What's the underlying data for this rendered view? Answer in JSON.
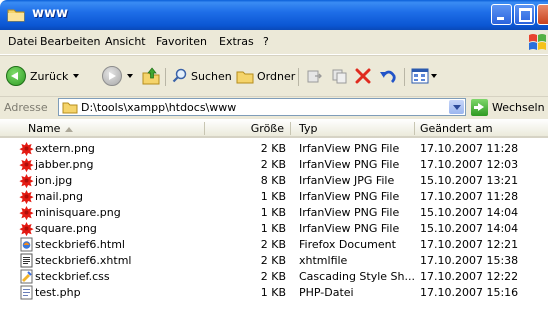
{
  "window": {
    "title": "www"
  },
  "menu": [
    "Datei",
    "Bearbeiten",
    "Ansicht",
    "Favoriten",
    "Extras",
    "?"
  ],
  "toolbar": {
    "back_label": "Zurück",
    "search_label": "Suchen",
    "folders_label": "Ordner"
  },
  "address": {
    "label": "Adresse",
    "path": "D:\\tools\\xampp\\htdocs\\www",
    "go_label": "Wechseln zu"
  },
  "columns": {
    "name": "Name",
    "size": "Größe",
    "type": "Typ",
    "modified": "Geändert am"
  },
  "files": [
    {
      "icon": "irfanview-icon",
      "name": "extern.png",
      "size": "2 KB",
      "type": "IrfanView PNG File",
      "modified": "17.10.2007 11:28"
    },
    {
      "icon": "irfanview-icon",
      "name": "jabber.png",
      "size": "2 KB",
      "type": "IrfanView PNG File",
      "modified": "17.10.2007 12:03"
    },
    {
      "icon": "irfanview-icon",
      "name": "jon.jpg",
      "size": "8 KB",
      "type": "IrfanView JPG File",
      "modified": "15.10.2007 13:21"
    },
    {
      "icon": "irfanview-icon",
      "name": "mail.png",
      "size": "1 KB",
      "type": "IrfanView PNG File",
      "modified": "17.10.2007 11:28"
    },
    {
      "icon": "irfanview-icon",
      "name": "minisquare.png",
      "size": "1 KB",
      "type": "IrfanView PNG File",
      "modified": "15.10.2007 14:04"
    },
    {
      "icon": "irfanview-icon",
      "name": "square.png",
      "size": "1 KB",
      "type": "IrfanView PNG File",
      "modified": "15.10.2007 14:04"
    },
    {
      "icon": "html-file-icon",
      "name": "steckbrief6.html",
      "size": "2 KB",
      "type": "Firefox Document",
      "modified": "17.10.2007 12:21"
    },
    {
      "icon": "xhtml-file-icon",
      "name": "steckbrief6.xhtml",
      "size": "2 KB",
      "type": "xhtmlfile",
      "modified": "17.10.2007 15:38"
    },
    {
      "icon": "css-file-icon",
      "name": "steckbrief.css",
      "size": "2 KB",
      "type": "Cascading Style Sh...",
      "modified": "17.10.2007 12:22"
    },
    {
      "icon": "php-file-icon",
      "name": "test.php",
      "size": "1 KB",
      "type": "PHP-Datei",
      "modified": "17.10.2007 15:16"
    }
  ]
}
